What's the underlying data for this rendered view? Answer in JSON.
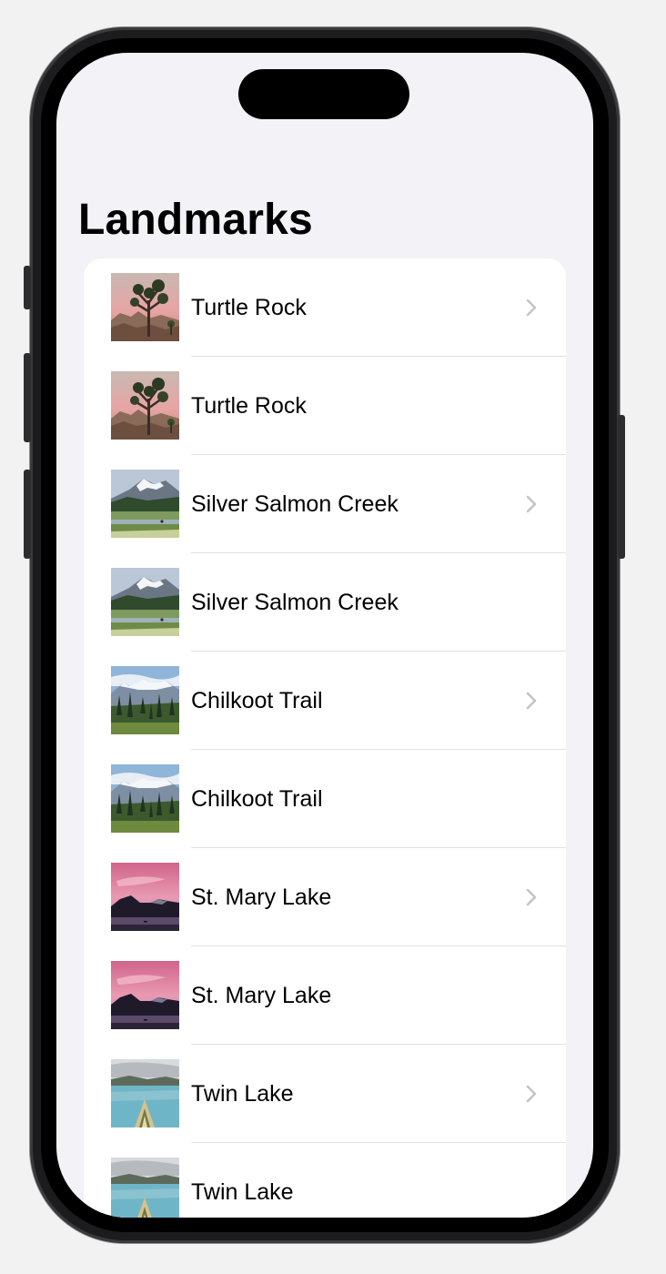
{
  "nav": {
    "title": "Landmarks"
  },
  "landmarks": [
    {
      "name": "Turtle Rock",
      "image_icon": "joshua-tree-photo",
      "has_chevron": true
    },
    {
      "name": "Turtle Rock",
      "image_icon": "joshua-tree-photo",
      "has_chevron": false
    },
    {
      "name": "Silver Salmon Creek",
      "image_icon": "mountain-meadow-photo",
      "has_chevron": true
    },
    {
      "name": "Silver Salmon Creek",
      "image_icon": "mountain-meadow-photo",
      "has_chevron": false
    },
    {
      "name": "Chilkoot Trail",
      "image_icon": "forest-mountain-photo",
      "has_chevron": true
    },
    {
      "name": "Chilkoot Trail",
      "image_icon": "forest-mountain-photo",
      "has_chevron": false
    },
    {
      "name": "St. Mary Lake",
      "image_icon": "sunset-lake-photo",
      "has_chevron": true
    },
    {
      "name": "St. Mary Lake",
      "image_icon": "sunset-lake-photo",
      "has_chevron": false
    },
    {
      "name": "Twin Lake",
      "image_icon": "kayak-lake-photo",
      "has_chevron": true
    },
    {
      "name": "Twin Lake",
      "image_icon": "kayak-lake-photo",
      "has_chevron": false
    }
  ],
  "colors": {
    "background": "#f2f2f7",
    "list_background": "#ffffff",
    "separator": "#e0e0e5",
    "chevron": "#c4c4c7"
  }
}
